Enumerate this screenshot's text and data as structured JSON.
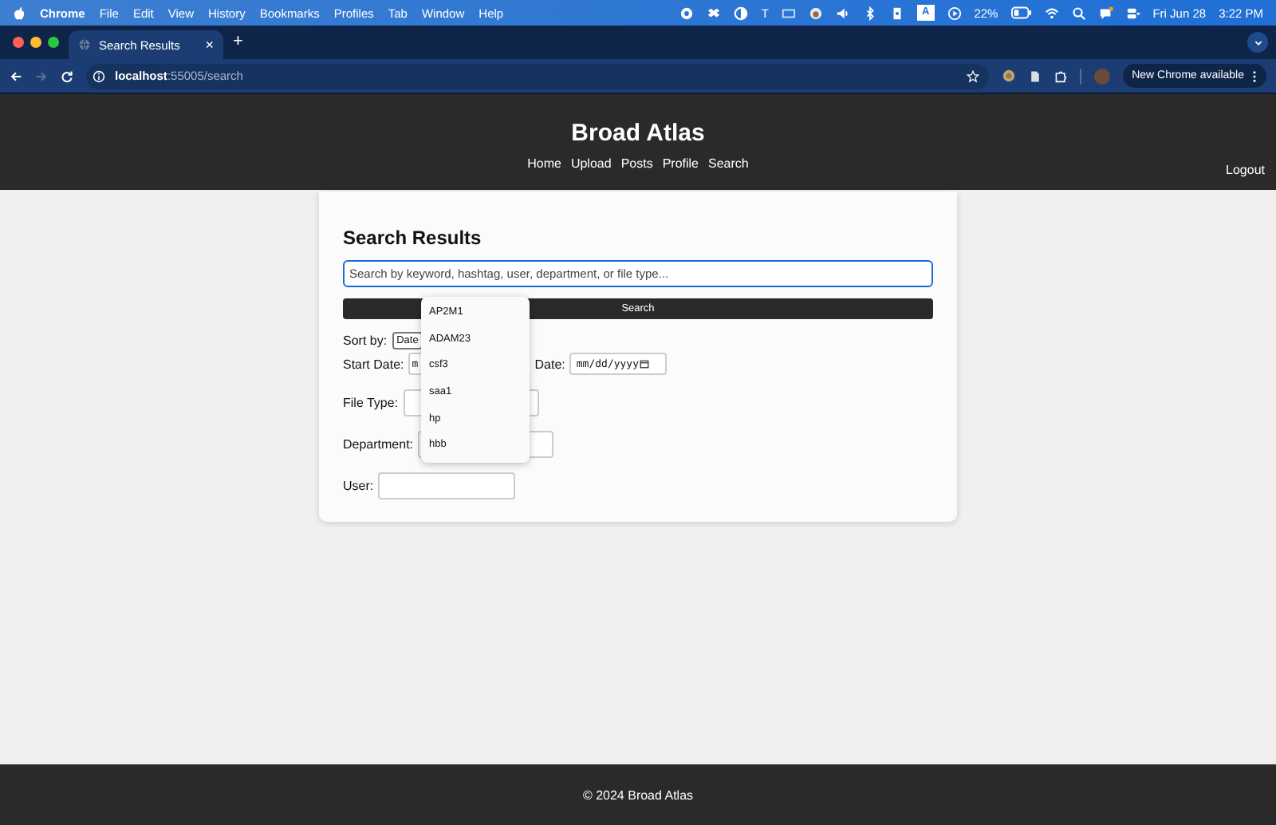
{
  "menu_bar": {
    "app": "Chrome",
    "items": [
      "File",
      "Edit",
      "View",
      "History",
      "Bookmarks",
      "Profiles",
      "Tab",
      "Window",
      "Help"
    ],
    "status_text": "T",
    "input_source": "A",
    "battery": "22%",
    "date": "Fri Jun 28",
    "time": "3:22 PM"
  },
  "browser": {
    "tabs": [
      {
        "label": "Search Results",
        "selected": true,
        "close": "×"
      }
    ],
    "new_tab": "+",
    "nav_buttons": [
      {
        "kind": "back",
        "disabled": false
      },
      {
        "kind": "forward",
        "disabled": true
      },
      {
        "kind": "reload",
        "disabled": false
      }
    ],
    "url_host": "localhost",
    "url_path": ":55005/search",
    "update_button": "New Chrome available"
  },
  "header": {
    "title": "Broad Atlas",
    "nav": [
      "Home",
      "Upload",
      "Posts",
      "Profile",
      "Search"
    ],
    "logout": "Logout"
  },
  "search": {
    "title": "Search Results",
    "placeholder": "Search by keyword, hashtag, user, department, or file type...",
    "button": "Search",
    "sort_label": "Sort by:",
    "sort_value": "Date",
    "start_label": "Start Date:",
    "start_value": "m",
    "end_label": "Date:",
    "end_value": "mm/dd/yyyy",
    "file_type_label": "File Type:",
    "department_label": "Department:",
    "user_label": "User:",
    "suggestions": [
      "AP2M1",
      "ADAM23",
      "csf3",
      "saa1",
      "hp",
      "hbb"
    ]
  },
  "footer": "© 2024 Broad Atlas"
}
